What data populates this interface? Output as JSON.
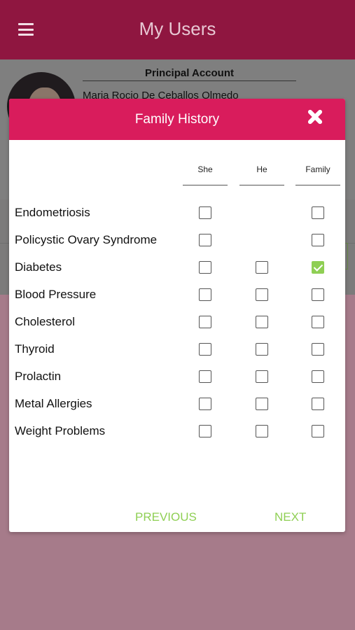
{
  "header": {
    "title": "My Users",
    "menu_icon": "hamburger-menu-icon"
  },
  "background_card": {
    "section_label": "Principal Account",
    "user_name": "Maria Rocio De Ceballos Olmedo"
  },
  "modal": {
    "title": "Family History",
    "close_icon": "close-icon",
    "columns": [
      "She",
      "He",
      "Family"
    ],
    "rows": [
      {
        "label": "Endometriosis",
        "she": false,
        "he": null,
        "family": false
      },
      {
        "label": "Policystic Ovary Syndrome",
        "she": false,
        "he": null,
        "family": false
      },
      {
        "label": "Diabetes",
        "she": false,
        "he": false,
        "family": true
      },
      {
        "label": "Blood Pressure",
        "she": false,
        "he": false,
        "family": false
      },
      {
        "label": "Cholesterol",
        "she": false,
        "he": false,
        "family": false
      },
      {
        "label": "Thyroid",
        "she": false,
        "he": false,
        "family": false
      },
      {
        "label": "Prolactin",
        "she": false,
        "he": false,
        "family": false
      },
      {
        "label": "Metal Allergies",
        "she": false,
        "he": false,
        "family": false
      },
      {
        "label": "Weight Problems",
        "she": false,
        "he": false,
        "family": false
      }
    ],
    "previous_label": "PREVIOUS",
    "next_label": "NEXT"
  },
  "colors": {
    "header_bg": "#8f1640",
    "modal_header_bg": "#d91c5c",
    "accent_green": "#8fcf54",
    "page_bg": "#a67b8a"
  }
}
